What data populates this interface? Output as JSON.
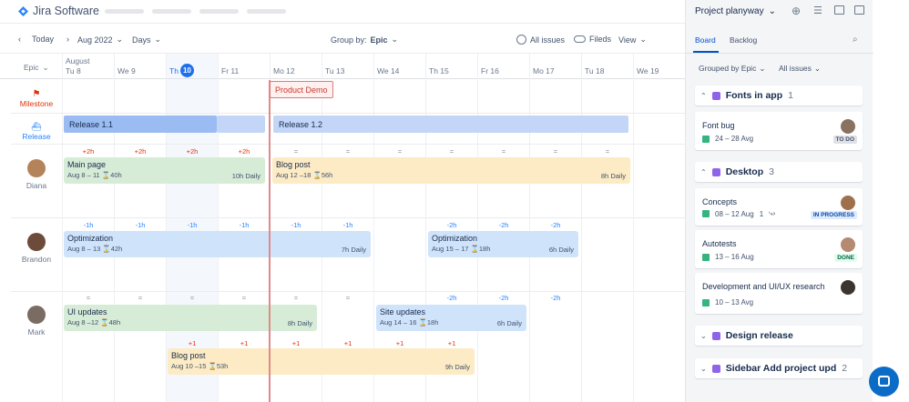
{
  "app": {
    "name": "Jira Software"
  },
  "toolbar": {
    "today": "Today",
    "month": "Aug 2022",
    "scale": "Days",
    "group_by_label": "Group by:",
    "group_by_value": "Epic",
    "all_issues": "All issues",
    "fields": "Fileds",
    "view": "View"
  },
  "header": {
    "epic": "Epic",
    "month": "August",
    "days": [
      "Tu 8",
      "We 9",
      "Th",
      "Fr 11",
      "Mo 12",
      "Tu 13",
      "We 14",
      "Th 15",
      "Fr 16",
      "Mo 17",
      "Tu 18",
      "We 19"
    ],
    "today_num": "10"
  },
  "rows": {
    "milestone": "Milestone",
    "release": "Release",
    "people": [
      "Diana",
      "Brandon",
      "Mark"
    ]
  },
  "milestone": {
    "label": "Product Demo"
  },
  "releases": [
    "Release 1.1",
    "Release 1.2"
  ],
  "caps": {
    "diana": [
      "+2h",
      "+2h",
      "+2h",
      "+2h",
      "=",
      "=",
      "=",
      "=",
      "=",
      "=",
      "="
    ],
    "brandon": [
      "-1h",
      "-1h",
      "-1h",
      "-1h",
      "-1h",
      "-1h",
      "-2h",
      "-2h",
      "-2h"
    ],
    "mark": [
      "=",
      "=",
      "=",
      "=",
      "=",
      "=",
      "-2h",
      "-2h",
      "-2h"
    ],
    "mark2": [
      "+1",
      "+1",
      "+1",
      "+1",
      "+1",
      "+1"
    ]
  },
  "bars": [
    {
      "title": "Main page",
      "dates": "Aug 8 – 11",
      "hours": "40h",
      "rate": "10h Daily"
    },
    {
      "title": "Blog post",
      "dates": "Aug 12 –18",
      "hours": "56h",
      "rate": "8h Daily"
    },
    {
      "title": "Optimization",
      "dates": "Aug 8 – 13",
      "hours": "42h",
      "rate": "7h Daily"
    },
    {
      "title": "Optimization",
      "dates": "Aug 15 – 17",
      "hours": "18h",
      "rate": "6h Daily"
    },
    {
      "title": "UI updates",
      "dates": "Aug 8 –12",
      "hours": "48h",
      "rate": "8h Daily"
    },
    {
      "title": "Site updates",
      "dates": "Aug 14 – 16",
      "hours": "18h",
      "rate": "6h Daily"
    },
    {
      "title": "Blog post",
      "dates": "Aug 10 –15",
      "hours": "53h",
      "rate": "9h Daily"
    }
  ],
  "panel": {
    "project": "Project planyway",
    "tabs": [
      "Board",
      "Backlog"
    ],
    "grouped": "Grouped by Epic",
    "all": "All issues",
    "groups": [
      {
        "name": "Fonts in app",
        "count": "1"
      },
      {
        "name": "Desktop",
        "count": "3"
      },
      {
        "name": "Design release",
        "count": ""
      },
      {
        "name": "Sidebar Add project upd",
        "count": "2"
      }
    ],
    "items": [
      {
        "title": "Font bug",
        "dates": "24 – 28 Avg",
        "status": "TO DO"
      },
      {
        "title": "Concepts",
        "dates": "08 – 12 Aug",
        "extra": "1",
        "status": "IN PROGRESS"
      },
      {
        "title": "Autotests",
        "dates": "13 – 16 Aug",
        "status": "DONE"
      },
      {
        "title": "Development and UI/UX research",
        "dates": "10 – 13 Avg",
        "status": ""
      }
    ]
  },
  "colors": {
    "accent": "#0052cc",
    "today": "#1f6feb",
    "milestone": "#c9372c"
  }
}
